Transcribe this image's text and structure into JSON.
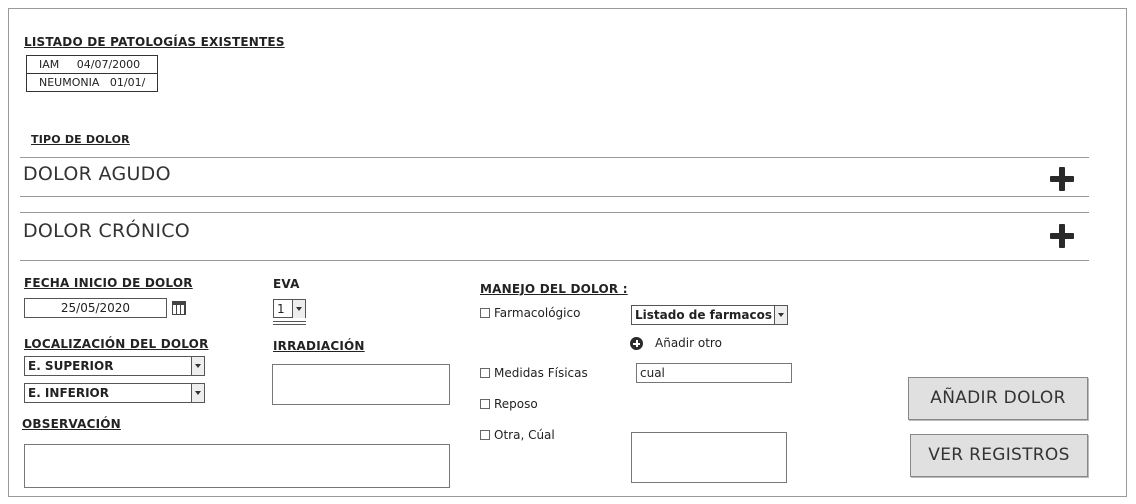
{
  "pathologies": {
    "title": "LISTADO DE PATOLOGÍAS EXISTENTES",
    "rows": [
      {
        "name": "IAM",
        "date": "04/07/2000"
      },
      {
        "name": "NEUMONIA",
        "date": "01/01/"
      }
    ]
  },
  "pain_type": {
    "title": "TIPO DE DOLOR",
    "sections": [
      {
        "label": "DOLOR AGUDO",
        "icon": "plus-icon"
      },
      {
        "label": "DOLOR CRÓNICO",
        "icon": "plus-icon"
      }
    ]
  },
  "form": {
    "start_date_label": "FECHA INICIO DE DOLOR",
    "start_date_value": "25/05/2020",
    "calendar_icon": "calendar-icon",
    "eva_label": "EVA",
    "eva_value": "1",
    "location_label": "LOCALIZACIÓN DEL DOLOR",
    "location_values": [
      "E. SUPERIOR",
      "E. INFERIOR"
    ],
    "irradiation_label": "IRRADIACIÓN",
    "observation_label": "OBSERVACIÓN",
    "management_label": "MANEJO DEL DOLOR :",
    "options": {
      "pharmacological": "Farmacológico",
      "physical": "Medidas Físicas",
      "rest": "Reposo",
      "other": "Otra, Cúal"
    },
    "drug_list_value": "Listado de farmacos",
    "add_other_label": "Añadir otro",
    "physical_measure_value": "cual"
  },
  "buttons": {
    "add_pain": "AÑADIR DOLOR",
    "view_records": "VER REGISTROS"
  }
}
